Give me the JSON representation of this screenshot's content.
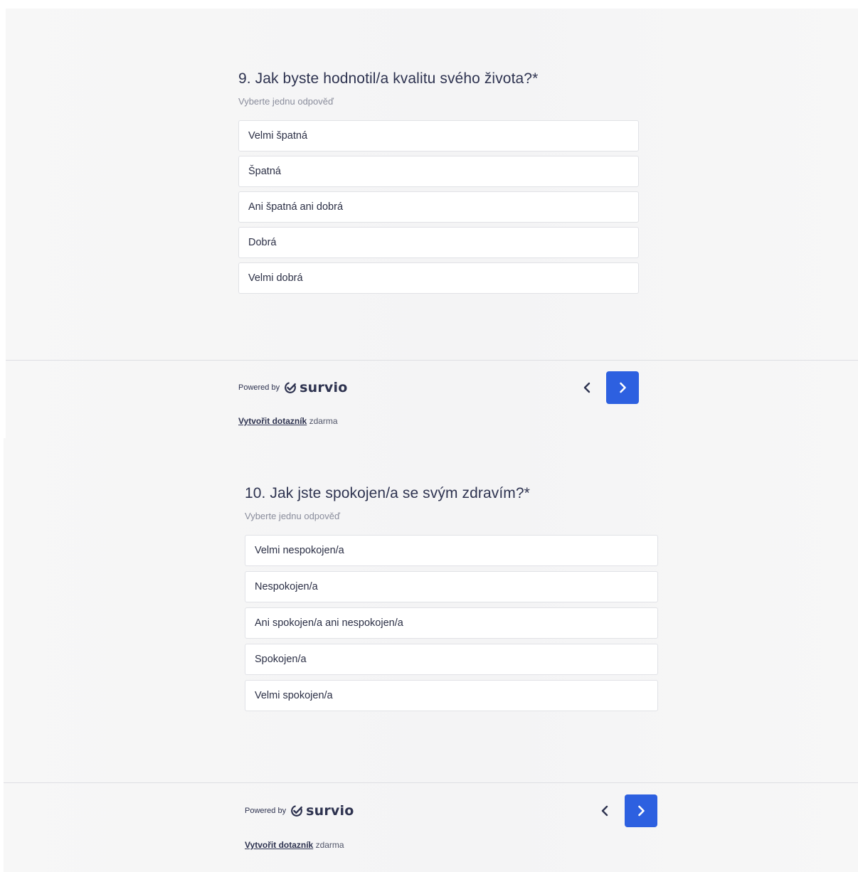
{
  "questions": [
    {
      "title": "9. Jak byste hodnotil/a kvalitu svého života?*",
      "hint": "Vyberte jednu odpověď",
      "options": [
        "Velmi špatná",
        "Špatná",
        "Ani špatná ani dobrá",
        "Dobrá",
        "Velmi dobrá"
      ]
    },
    {
      "title": "10. Jak jste spokojen/a se svým zdravím?*",
      "hint": "Vyberte jednu odpověď",
      "options": [
        "Velmi nespokojen/a",
        "Nespokojen/a",
        "Ani spokojen/a ani nespokojen/a",
        "Spokojen/a",
        "Velmi spokojen/a"
      ]
    }
  ],
  "footer": {
    "powered_by": "Powered by",
    "brand": "survio",
    "create_link": "Vytvořit dotazník",
    "create_suffix": "zdarma"
  },
  "icons": {
    "prev": "chevron-left-icon",
    "next": "chevron-right-icon",
    "logo": "survio-check-logo-icon"
  },
  "colors": {
    "accent": "#2d60e0",
    "text": "#2e3350",
    "hint": "#8a8d9c",
    "option_border": "#e1e2e6"
  }
}
